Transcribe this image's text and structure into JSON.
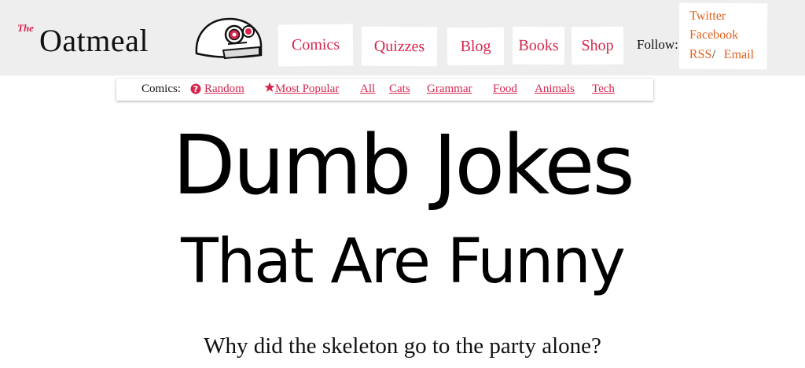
{
  "brand": {
    "the_text": "The",
    "name_text": "Oatmeal",
    "accent_color": "#d6264d",
    "follow_color": "#e0601e",
    "mascot_icon": "helmet-mascot-icon"
  },
  "nav": {
    "comics": "Comics",
    "quizzes": "Quizzes",
    "blog": "Blog",
    "books": "Books",
    "shop": "Shop"
  },
  "follow": {
    "label": "Follow:",
    "twitter": "Twitter",
    "facebook": "Facebook",
    "rss": "RSS",
    "separator": "/",
    "email": "Email"
  },
  "subnav": {
    "label": "Comics:",
    "random": "Random",
    "random_icon": "question-icon",
    "most_popular": "Most Popular",
    "most_popular_icon": "star-icon",
    "all": "All",
    "cats": "Cats",
    "grammar": "Grammar",
    "food": "Food",
    "animals": "Animals",
    "tech": "Tech"
  },
  "page": {
    "title_line1": "Dumb Jokes",
    "title_line2": "That Are Funny",
    "question": "Why did the skeleton go to the party alone?"
  }
}
